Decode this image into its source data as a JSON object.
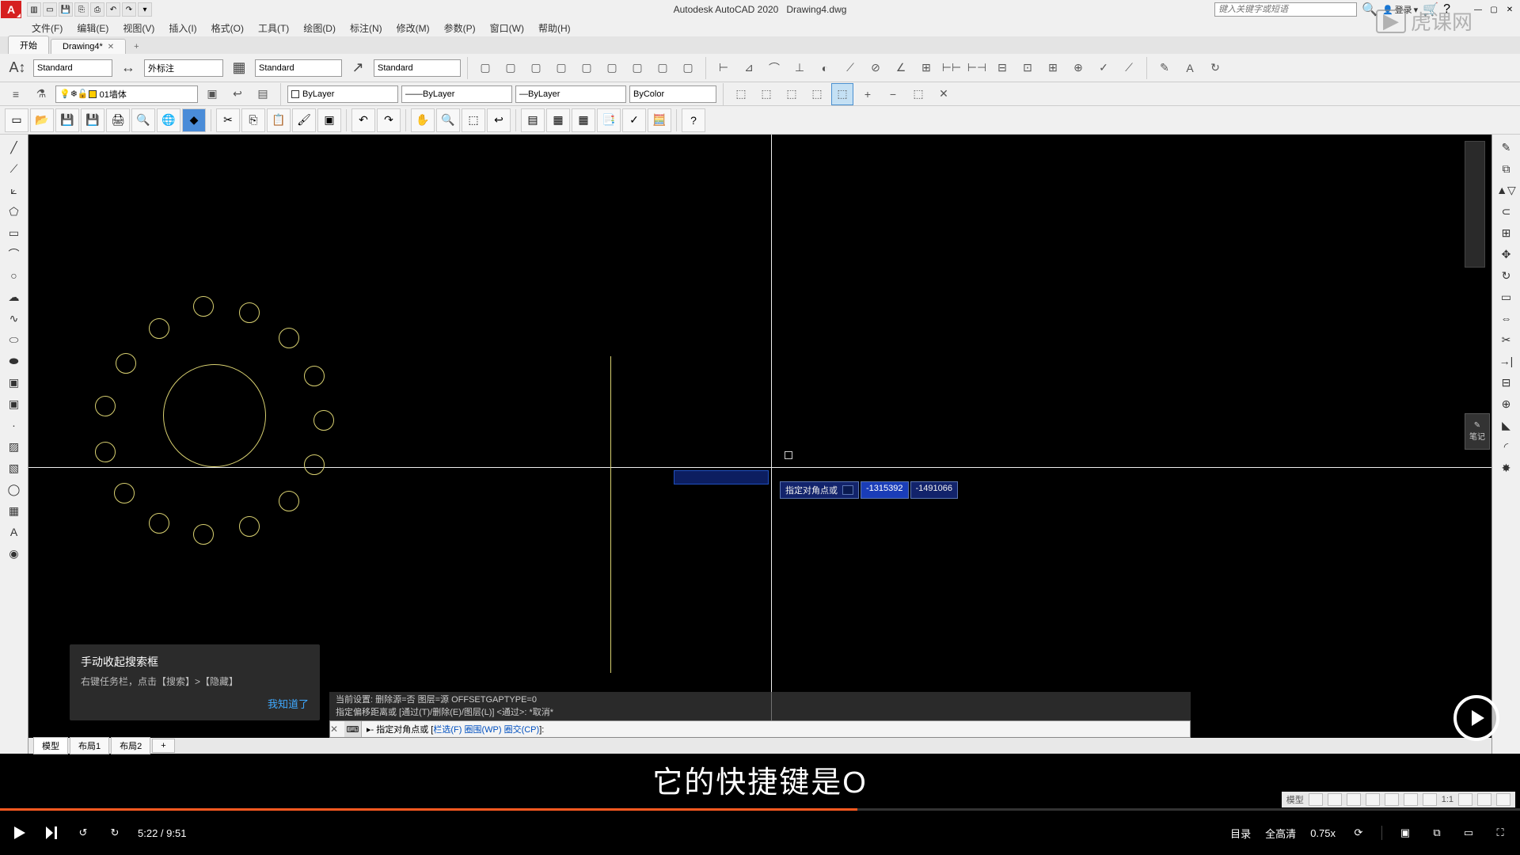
{
  "title": {
    "app": "Autodesk AutoCAD 2020",
    "file": "Drawing4.dwg"
  },
  "search_placeholder": "键入关键字或短语",
  "login_label": "登录",
  "menus": {
    "file": "文件(F)",
    "edit": "编辑(E)",
    "view": "视图(V)",
    "insert": "插入(I)",
    "format": "格式(O)",
    "tools": "工具(T)",
    "draw": "绘图(D)",
    "dimension": "标注(N)",
    "modify": "修改(M)",
    "param": "参数(P)",
    "window": "窗口(W)",
    "help": "帮助(H)"
  },
  "tabs": {
    "start": "开始",
    "current": "Drawing4*"
  },
  "ribbon": {
    "text_style": "Standard",
    "dim_style": "外标注",
    "table_style": "Standard",
    "mleader_style": "Standard",
    "layer_name": "01墙体",
    "linetype": "ByLayer",
    "lineweight": "ByLayer",
    "color": "ByLayer",
    "plotstyle": "ByColor"
  },
  "dyn_input": {
    "label": "指定对角点或",
    "x": "-1315392",
    "y": "-1491066"
  },
  "cmd": {
    "hist1": "当前设置: 删除源=否  图层=源  OFFSETGAPTYPE=0",
    "hist2": "指定偏移距离或 [通过(T)/删除(E)/图层(L)] <通过>:  *取消*",
    "prompt_pre": "▸- 指定对角点或 [",
    "opt1": "栏选(F)",
    "opt2": "圈围(WP)",
    "opt3": "圈交(CP)",
    "prompt_post": "]:"
  },
  "tooltip": {
    "title": "手动收起搜索框",
    "sub": "右键任务栏，点击【搜索】>【隐藏】",
    "ok": "我知道了"
  },
  "model_tabs": {
    "model": "模型",
    "layout1": "布局1",
    "layout2": "布局2"
  },
  "status": {
    "model": "模型",
    "scale": "1:1"
  },
  "subtitle": "它的快捷键是O",
  "player": {
    "time_current": "5:22",
    "time_total": "9:51",
    "catalog": "目录",
    "quality": "全高清",
    "speed": "0.75x"
  },
  "watermark": "虎课网",
  "edit_label": "笔记"
}
